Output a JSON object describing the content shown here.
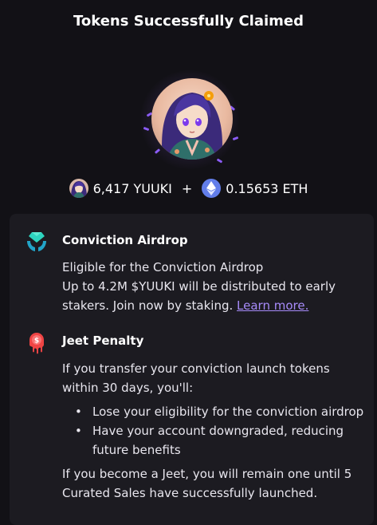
{
  "header": {
    "title": "Tokens Successfully Claimed"
  },
  "claim": {
    "yuuki_amount": "6,417 YUUKI",
    "plus": "+",
    "eth_amount": "0.15653 ETH"
  },
  "conviction": {
    "icon": "diamond-hands-icon",
    "title": "Conviction Airdrop",
    "line1": "Eligible for the Conviction Airdrop",
    "line2": "Up to 4.2M $YUUKI will be distributed to early stakers. Join now by staking.",
    "link": "Learn more."
  },
  "jeet": {
    "icon": "melting-coin-icon",
    "title": "Jeet Penalty",
    "intro": "If you transfer your conviction launch tokens within 30 days, you'll:",
    "bullets": [
      "Lose your eligibility for the conviction airdrop",
      "Have your account downgraded, reducing future benefits"
    ],
    "outro": "If you become a Jeet, you will remain one until 5 Curated Sales have successfully launched."
  },
  "colors": {
    "accent": "#a78bfa",
    "eth": "#627eea",
    "diamond": "#2dd4bf",
    "penalty": "#ef4444"
  }
}
